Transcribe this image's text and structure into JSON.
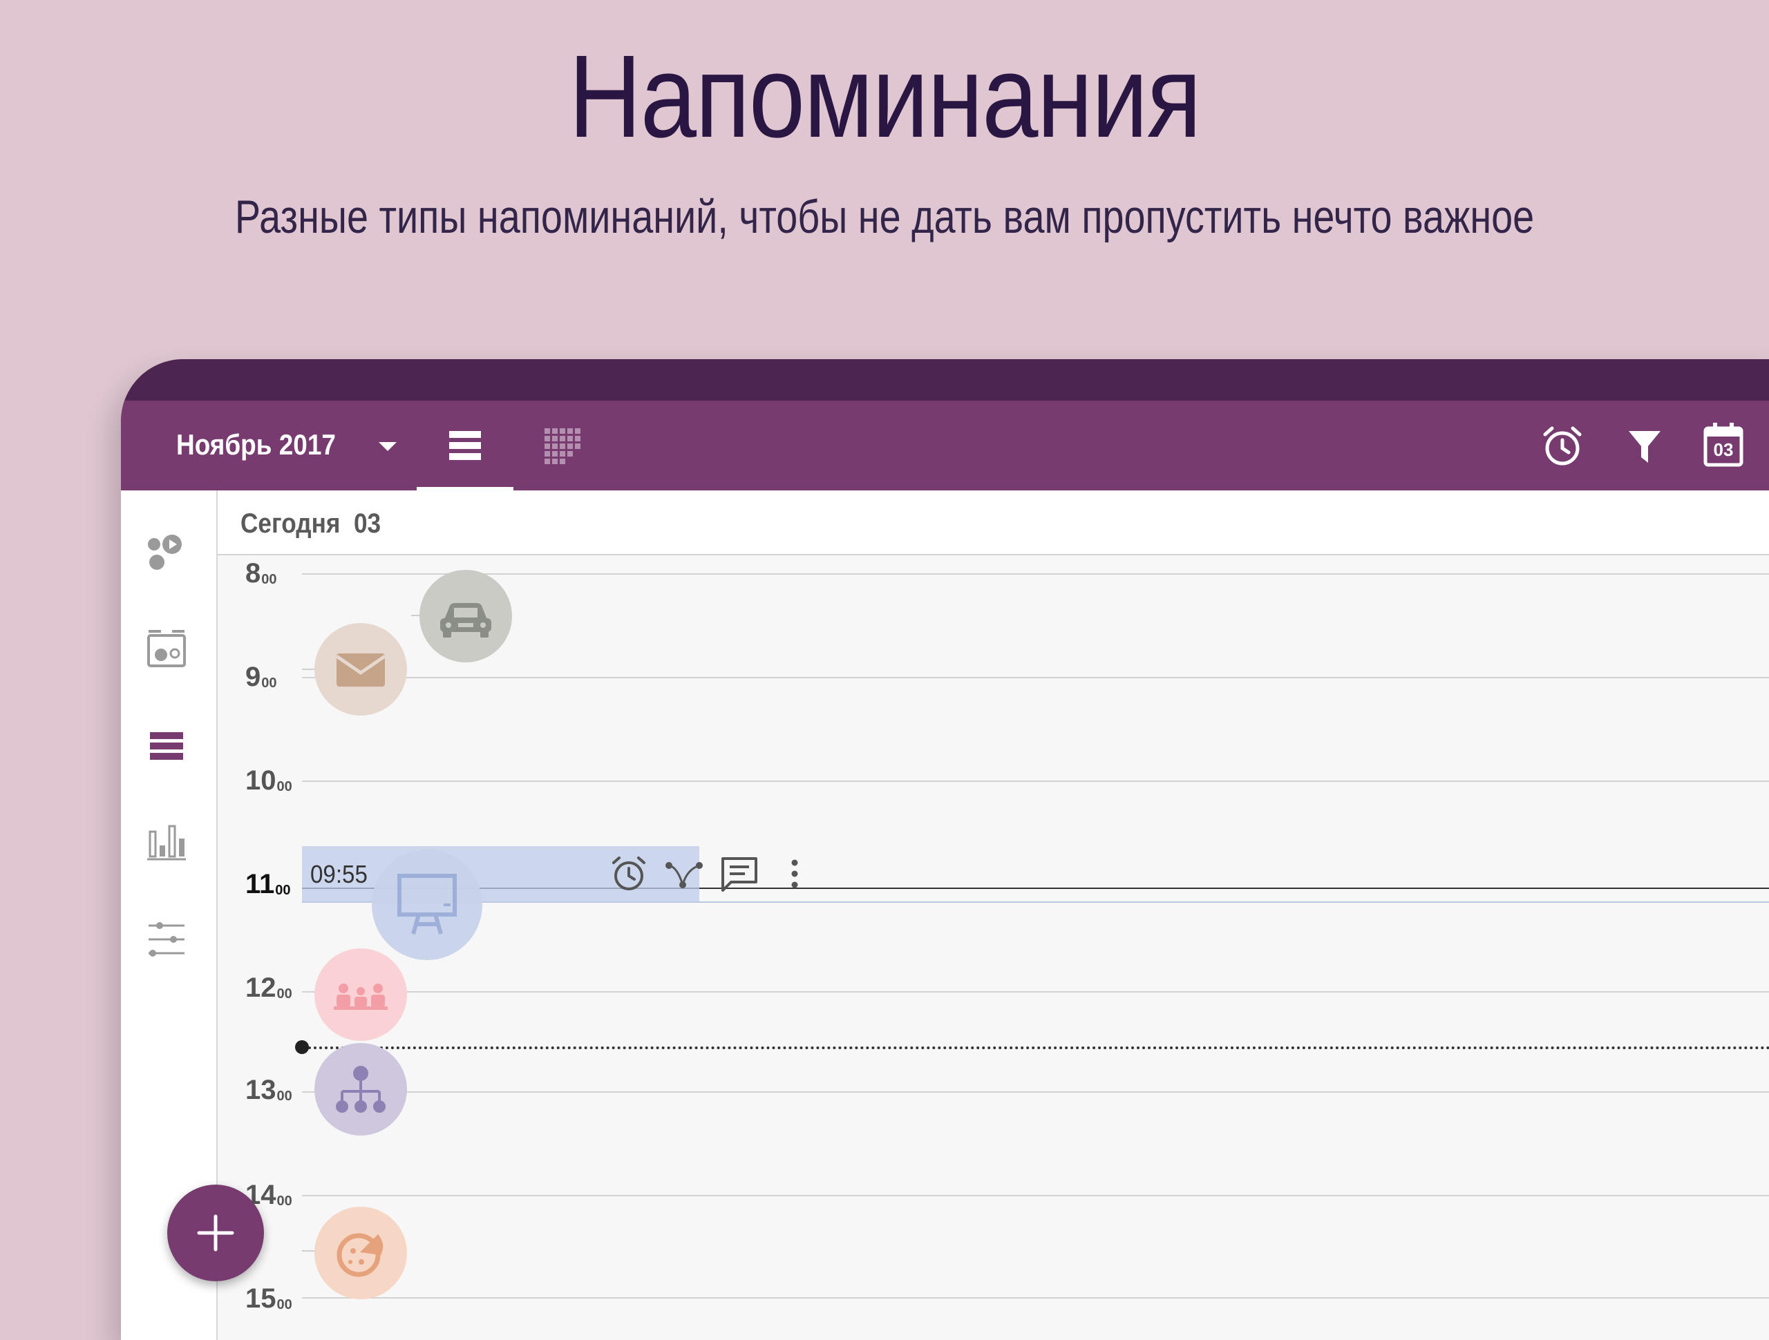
{
  "promo": {
    "title": "Напоминания",
    "subtitle": "Разные типы напоминаний, чтобы не дать вам пропустить нечто важное"
  },
  "toolbar": {
    "month": "Ноябрь 2017",
    "calendar_badge": "03",
    "icons": [
      "alarm-icon",
      "filter-icon",
      "calendar-today-icon"
    ],
    "view_tabs": [
      "list-view-icon",
      "grid-view-icon"
    ],
    "selected_tab": "list-view-icon"
  },
  "nav": {
    "items": [
      "activities-icon",
      "categories-icon",
      "day-view-icon",
      "statistics-icon",
      "settings-icon"
    ],
    "selected": "day-view-icon"
  },
  "day": {
    "header_prefix": "Сегодня",
    "header_day": "03",
    "hours": [
      {
        "h": "8",
        "m": "00"
      },
      {
        "h": "9",
        "m": "00"
      },
      {
        "h": "10",
        "m": "00"
      },
      {
        "h": "11",
        "m": "00"
      },
      {
        "h": "12",
        "m": "00"
      },
      {
        "h": "13",
        "m": "00"
      },
      {
        "h": "14",
        "m": "00"
      },
      {
        "h": "15",
        "m": "00"
      }
    ]
  },
  "active_reminder": {
    "time": "09:55",
    "icons": [
      "alarm-icon",
      "route-icon",
      "comment-icon",
      "more-vert-icon"
    ]
  },
  "events": [
    {
      "icon": "car-icon",
      "color": "#c9cbc4"
    },
    {
      "icon": "mail-icon",
      "color": "#e6d8cf"
    },
    {
      "icon": "presentation-icon",
      "color": "#c8d3ea"
    },
    {
      "icon": "meeting-icon",
      "color": "#fad2d6"
    },
    {
      "icon": "hierarchy-icon",
      "color": "#cfc7de"
    },
    {
      "icon": "pizza-icon",
      "color": "#f6d6c4"
    }
  ],
  "colors": {
    "primary": "#773b6f",
    "primary_dark": "#4c2550",
    "background": "#dfc6d1"
  }
}
